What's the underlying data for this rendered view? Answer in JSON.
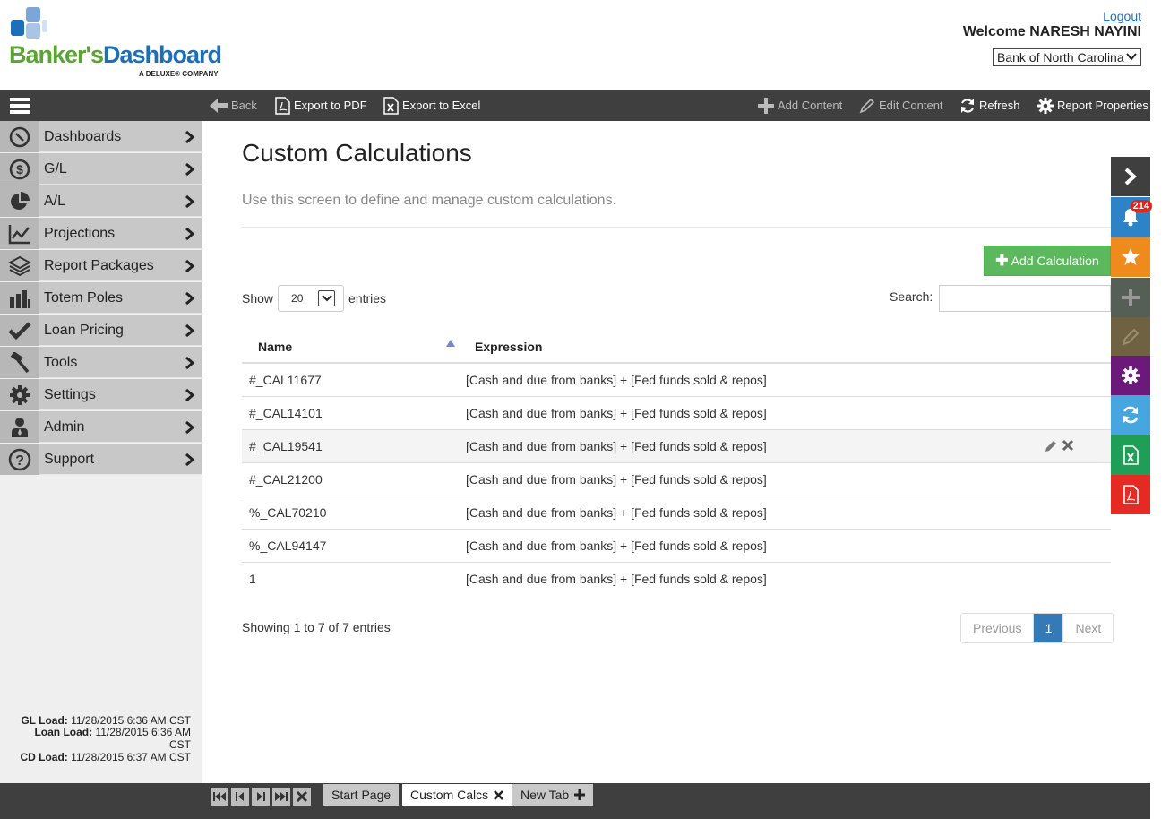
{
  "header": {
    "logo_text_1": "Banker's",
    "logo_text_2": "Dashboard",
    "logo_sub": "A DELUXE® COMPANY",
    "logout": "Logout",
    "welcome": "Welcome  NARESH NAYINI",
    "bank": "Bank of North Carolina"
  },
  "toolbar": {
    "back": "Back",
    "export_pdf": "Export to PDF",
    "export_excel": "Export to Excel",
    "add_content": "Add Content",
    "edit_content": "Edit Content",
    "refresh": "Refresh",
    "report_properties": "Report Properties"
  },
  "sidebar": {
    "items": [
      {
        "label": "Dashboards",
        "icon": "compass-icon"
      },
      {
        "label": "G/L",
        "icon": "dollar-icon"
      },
      {
        "label": "A/L",
        "icon": "pie-chart-icon"
      },
      {
        "label": "Projections",
        "icon": "line-chart-icon"
      },
      {
        "label": "Report Packages",
        "icon": "layers-icon"
      },
      {
        "label": "Totem Poles",
        "icon": "bar-chart-icon"
      },
      {
        "label": "Loan Pricing",
        "icon": "check-icon"
      },
      {
        "label": "Tools",
        "icon": "hammer-icon"
      },
      {
        "label": "Settings",
        "icon": "gear-icon"
      },
      {
        "label": "Admin",
        "icon": "user-icon"
      },
      {
        "label": "Support",
        "icon": "question-icon"
      }
    ],
    "loads": {
      "gl_label": "GL Load:",
      "gl_value": "11/28/2015 6:36 AM CST",
      "loan_label": "Loan Load:",
      "loan_value_1": "11/28/2015 6:36 AM",
      "loan_value_2": "CST",
      "cd_label": "CD Load:",
      "cd_value": "11/28/2015 6:37 AM CST"
    }
  },
  "main": {
    "title": "Custom Calculations",
    "description": "Use this screen to define and manage custom calculations.",
    "add_button": "Add Calculation",
    "show_label": "Show",
    "page_length": "20",
    "entries_label": "entries",
    "search_label": "Search:",
    "columns": [
      "Name",
      "Expression"
    ],
    "rows": [
      {
        "name": "#_CAL11677",
        "expression": "[Cash and due from banks] + [Fed funds sold & repos]"
      },
      {
        "name": "#_CAL14101",
        "expression": "[Cash and due from banks] + [Fed funds sold & repos]"
      },
      {
        "name": "#_CAL19541",
        "expression": "[Cash and due from banks] + [Fed funds sold & repos]"
      },
      {
        "name": "#_CAL21200",
        "expression": "[Cash and due from banks] + [Fed funds sold & repos]"
      },
      {
        "name": "%_CAL70210",
        "expression": "[Cash and due from banks] + [Fed funds sold & repos]"
      },
      {
        "name": "%_CAL94147",
        "expression": "[Cash and due from banks] + [Fed funds sold & repos]"
      },
      {
        "name": "1",
        "expression": "[Cash and due from banks] + [Fed funds sold & repos]"
      }
    ],
    "showing": "Showing 1 to 7 of 7 entries",
    "pager": {
      "previous": "Previous",
      "current": "1",
      "next": "Next"
    }
  },
  "rail": {
    "notifications_count": "214",
    "colors": {
      "collapse": "#3f3f3f",
      "notifications": "#2e83c6",
      "favorite": "#ef8a1c",
      "add": "#555f55",
      "edit": "#6f6243",
      "settings": "#6b1a7a",
      "refresh": "#45a6e0",
      "excel": "#1e9e57",
      "pdf": "#e52a24"
    }
  },
  "tabs": {
    "start": "Start Page",
    "current": "Custom Calcs",
    "new": "New Tab"
  }
}
